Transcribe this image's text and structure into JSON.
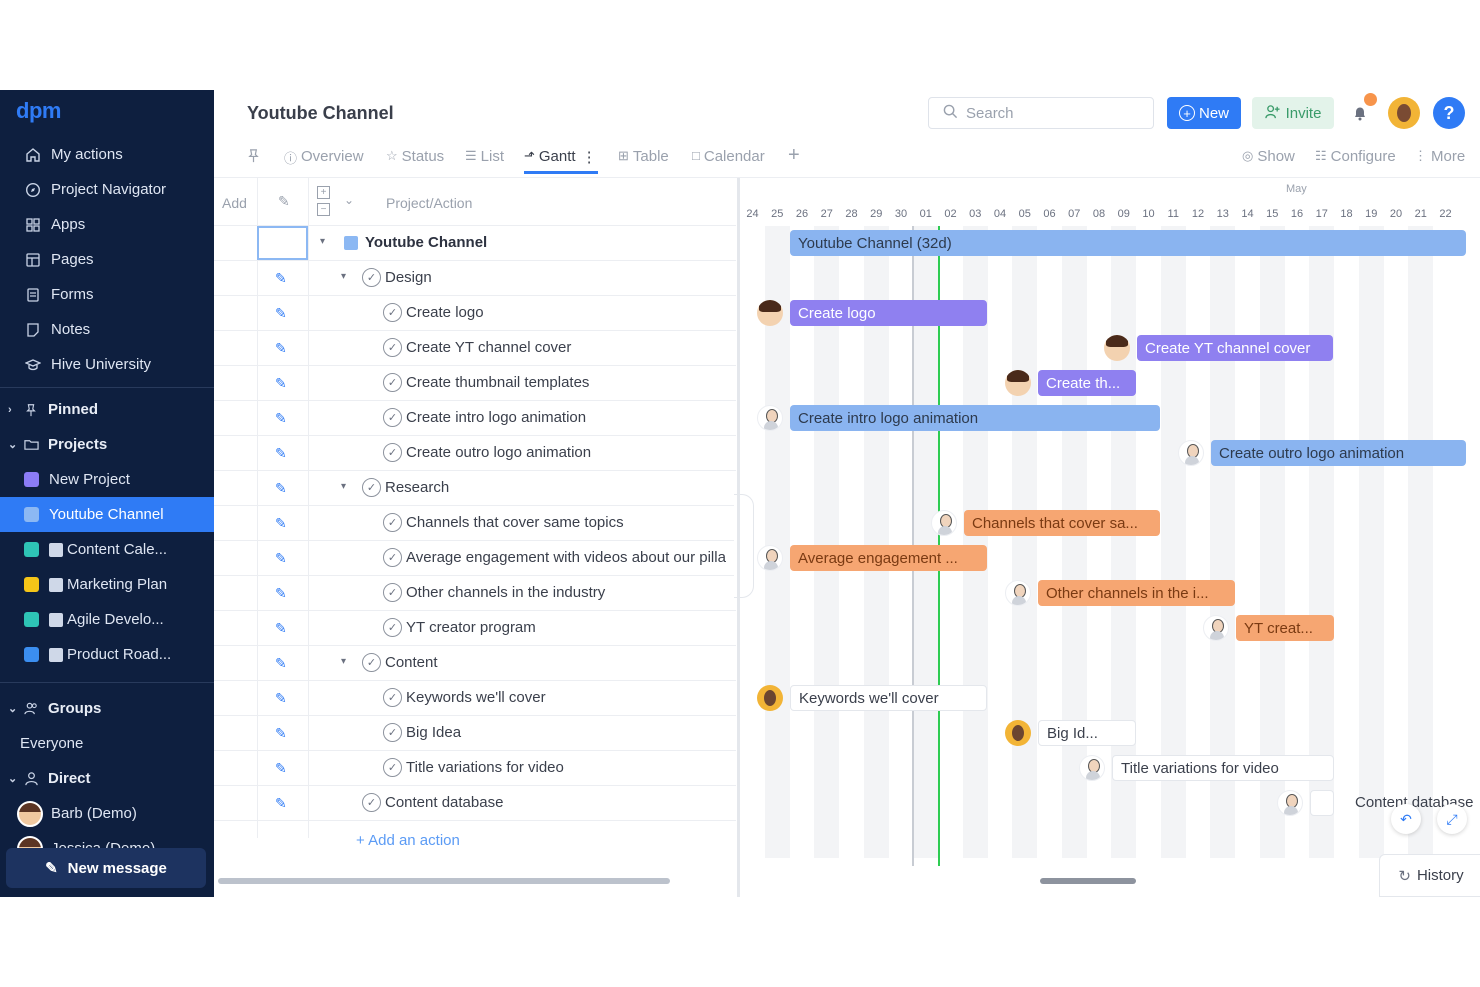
{
  "app": {
    "logo": "dpm"
  },
  "sidebar": {
    "nav": [
      {
        "label": "My actions",
        "icon": "home-icon"
      },
      {
        "label": "Project Navigator",
        "icon": "compass-icon"
      },
      {
        "label": "Apps",
        "icon": "grid-icon"
      },
      {
        "label": "Pages",
        "icon": "pages-icon"
      },
      {
        "label": "Forms",
        "icon": "forms-icon"
      },
      {
        "label": "Notes",
        "icon": "note-icon"
      },
      {
        "label": "Hive University",
        "icon": "graduation-cap-icon"
      }
    ],
    "pinned": "Pinned",
    "projects": "Projects",
    "project_list": [
      {
        "label": "New Project",
        "color": "#8b7cf6"
      },
      {
        "label": "Youtube Channel",
        "color": "#8cb8f3",
        "active": true
      },
      {
        "label": "Content Cale...",
        "color": "#2ec4b6"
      },
      {
        "label": "Marketing Plan",
        "color": "#f5c518"
      },
      {
        "label": "Agile Develo...",
        "color": "#2ec4b6"
      },
      {
        "label": "Product Road...",
        "color": "#3b8ef0"
      }
    ],
    "groups": "Groups",
    "everyone": "Everyone",
    "direct": "Direct",
    "users": [
      "Barb (Demo)",
      "Jessica (Demo)"
    ],
    "new_message": "New message"
  },
  "topbar": {
    "title": "Youtube Channel",
    "search_placeholder": "Search",
    "new_label": "New",
    "invite_label": "Invite",
    "help_label": "?"
  },
  "tabs": {
    "items": [
      "Overview",
      "Status",
      "List",
      "Gantt",
      "Table",
      "Calendar"
    ],
    "active": "Gantt",
    "add": "+",
    "show": "Show",
    "configure": "Configure",
    "more": "More"
  },
  "grid": {
    "header": {
      "add": "Add",
      "column": "Project/Action"
    },
    "rows": [
      {
        "label": "Youtube Channel",
        "level": 0,
        "type": "project"
      },
      {
        "label": "Design",
        "level": 1,
        "type": "group"
      },
      {
        "label": "Create logo",
        "level": 2
      },
      {
        "label": "Create YT channel cover",
        "level": 2
      },
      {
        "label": "Create thumbnail templates",
        "level": 2
      },
      {
        "label": "Create intro logo animation",
        "level": 2
      },
      {
        "label": "Create outro logo animation",
        "level": 2
      },
      {
        "label": "Research",
        "level": 1,
        "type": "group"
      },
      {
        "label": "Channels that cover same topics",
        "level": 2
      },
      {
        "label": "Average engagement with videos about our pilla",
        "level": 2
      },
      {
        "label": "Other channels in the industry",
        "level": 2
      },
      {
        "label": "YT creator program",
        "level": 2
      },
      {
        "label": "Content",
        "level": 1,
        "type": "group"
      },
      {
        "label": "Keywords we'll cover",
        "level": 2
      },
      {
        "label": "Big Idea",
        "level": 2
      },
      {
        "label": "Title variations for video",
        "level": 2
      },
      {
        "label": "Content database",
        "level": 1
      }
    ],
    "add_action": "+ Add an action"
  },
  "gantt": {
    "month": "May",
    "days": [
      "24",
      "25",
      "26",
      "27",
      "28",
      "29",
      "30",
      "01",
      "02",
      "03",
      "04",
      "05",
      "06",
      "07",
      "08",
      "09",
      "10",
      "11",
      "12",
      "13",
      "14",
      "15",
      "16",
      "17",
      "18",
      "19",
      "20",
      "21",
      "22"
    ],
    "bars": [
      {
        "label": "Youtube Channel (32d)",
        "row": 0
      },
      {
        "label": "Create logo",
        "row": 2
      },
      {
        "label": "Create YT channel cover",
        "row": 3
      },
      {
        "label": "Create th...",
        "row": 4
      },
      {
        "label": "Create intro logo animation",
        "row": 5
      },
      {
        "label": "Create outro logo animation",
        "row": 6
      },
      {
        "label": "Channels that cover sa...",
        "row": 8
      },
      {
        "label": "Average engagement ...",
        "row": 9
      },
      {
        "label": "Other channels in the i...",
        "row": 10
      },
      {
        "label": "YT creat...",
        "row": 11
      },
      {
        "label": "Keywords we'll cover",
        "row": 13
      },
      {
        "label": "Big Id...",
        "row": 14
      },
      {
        "label": "Title variations for video",
        "row": 15
      },
      {
        "label": "Content database",
        "row": 16
      }
    ],
    "history": "History"
  }
}
